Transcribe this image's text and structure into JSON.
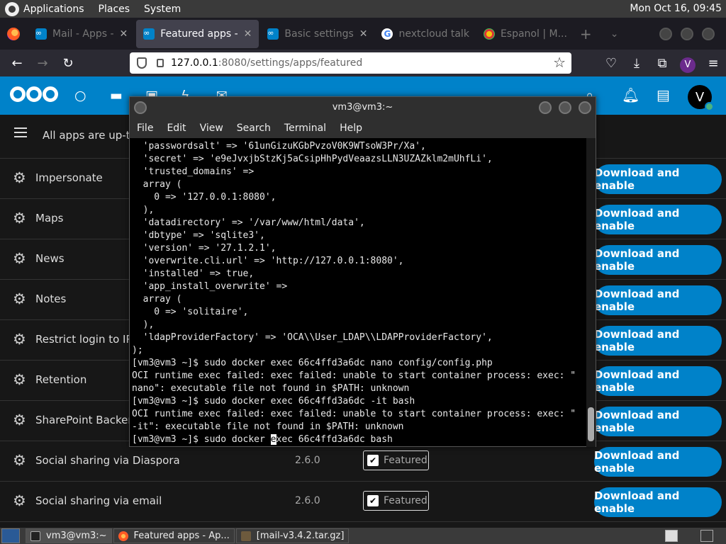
{
  "top_panel": {
    "menus": [
      "Applications",
      "Places",
      "System"
    ],
    "clock": "Mon Oct 16, 09:45"
  },
  "browser": {
    "tabs": [
      {
        "label": "Mail - Apps - ",
        "active": false
      },
      {
        "label": "Featured apps - ",
        "active": true
      },
      {
        "label": "Basic settings",
        "active": false
      },
      {
        "label": "nextcloud talk",
        "active": false
      },
      {
        "label": "Espanol | M...",
        "active": false
      }
    ],
    "url": {
      "host": "127.0.0.1",
      "path": ":8080/settings/apps/featured"
    },
    "profile_initial": "V"
  },
  "nextcloud": {
    "user_initial": "V",
    "toolbar_text": "All apps are up-to-",
    "apps": [
      {
        "name": "Impersonate",
        "version": "",
        "featured": false
      },
      {
        "name": "Maps",
        "version": "",
        "featured": false
      },
      {
        "name": "News",
        "version": "",
        "featured": false
      },
      {
        "name": "Notes",
        "version": "",
        "featured": false
      },
      {
        "name": "Restrict login to IP a",
        "version": "",
        "featured": false
      },
      {
        "name": "Retention",
        "version": "",
        "featured": false
      },
      {
        "name": "SharePoint Backend",
        "version": "",
        "featured": false
      },
      {
        "name": "Social sharing via Diaspora",
        "version": "2.6.0",
        "featured": true
      },
      {
        "name": "Social sharing via email",
        "version": "2.6.0",
        "featured": true
      }
    ],
    "featured_label": "Featured",
    "download_label": "Download and enable"
  },
  "terminal": {
    "title": "vm3@vm3:~",
    "menus": [
      "File",
      "Edit",
      "View",
      "Search",
      "Terminal",
      "Help"
    ],
    "lines": [
      "  'passwordsalt' => '61unGizuKGbPvzoV0K9WTsoW3Pr/Xa',",
      "  'secret' => 'e9eJvxjbStzKj5aCsipHhPydVeaazsLLN3UZAZklm2mUhfLi',",
      "  'trusted_domains' =>",
      "  array (",
      "    0 => '127.0.0.1:8080',",
      "  ),",
      "  'datadirectory' => '/var/www/html/data',",
      "  'dbtype' => 'sqlite3',",
      "  'version' => '27.1.2.1',",
      "  'overwrite.cli.url' => 'http://127.0.0.1:8080',",
      "  'installed' => true,",
      "  'app_install_overwrite' =>",
      "  array (",
      "    0 => 'solitaire',",
      "  ),",
      "  'ldapProviderFactory' => 'OCA\\\\User_LDAP\\\\LDAPProviderFactory',",
      ");",
      "[vm3@vm3 ~]$ sudo docker exec 66c4ffd3a6dc nano config/config.php",
      "OCI runtime exec failed: exec failed: unable to start container process: exec: \"",
      "nano\": executable file not found in $PATH: unknown",
      "[vm3@vm3 ~]$ sudo docker exec 66c4ffd3a6dc -it bash",
      "OCI runtime exec failed: exec failed: unable to start container process: exec: \"",
      "-it\": executable file not found in $PATH: unknown"
    ],
    "prompt_before_cursor": "[vm3@vm3 ~]$ sudo docker ",
    "cursor_char": "e",
    "prompt_after_cursor": "xec 66c4ffd3a6dc bash"
  },
  "taskbar": {
    "tasks": [
      {
        "label": "vm3@vm3:~",
        "active": true
      },
      {
        "label": "Featured apps - Ap...",
        "active": false
      },
      {
        "label": "[mail-v3.4.2.tar.gz]",
        "active": false
      }
    ]
  }
}
